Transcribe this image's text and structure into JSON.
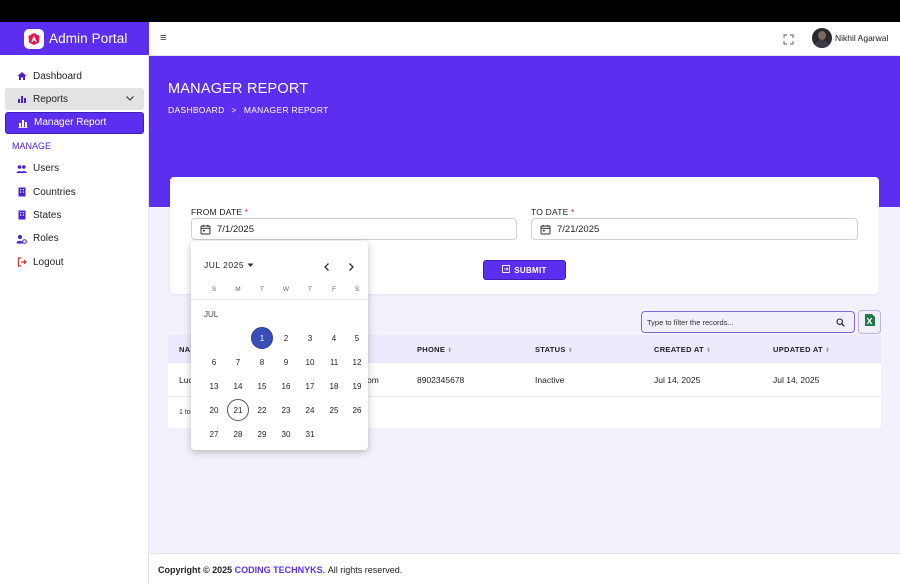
{
  "app": {
    "title": "Admin Portal",
    "accent": "#5b2ef0"
  },
  "sidebar": {
    "items": [
      {
        "label": "Dashboard",
        "icon": "home-icon"
      },
      {
        "label": "Reports",
        "icon": "bar-chart-icon"
      },
      {
        "label": "Manager Report",
        "icon": "bar-chart-outline-icon"
      }
    ],
    "section_label": "MANAGE",
    "manage_items": [
      {
        "label": "Users",
        "icon": "users-icon"
      },
      {
        "label": "Countries",
        "icon": "building-icon"
      },
      {
        "label": "States",
        "icon": "building-icon"
      },
      {
        "label": "Roles",
        "icon": "user-gear-icon"
      },
      {
        "label": "Logout",
        "icon": "logout-icon"
      }
    ]
  },
  "topbar": {
    "menu_icon": "≡",
    "user_name": "Nikhil Agarwal"
  },
  "hero": {
    "title": "MANAGER REPORT",
    "breadcrumb": [
      "DASHBOARD",
      ">",
      "MANAGER REPORT"
    ]
  },
  "filters": {
    "from_label": "FROM DATE",
    "from_value": "7/1/2025",
    "to_label": "TO DATE",
    "to_value": "7/21/2025",
    "required_mark": "*",
    "submit_label": "SUBMIT"
  },
  "search": {
    "placeholder": "Type to filter the records..."
  },
  "table": {
    "columns": [
      "NA",
      "PHONE",
      "STATUS",
      "CREATED AT",
      "UPDATED AT"
    ],
    "rows": [
      {
        "name": "Luc",
        "email_tail": "om",
        "phone": "8902345678",
        "status": "Inactive",
        "created": "Jul 14, 2025",
        "updated": "Jul 14, 2025"
      }
    ],
    "footer": "1 to"
  },
  "datepicker": {
    "month_year": "JUL 2025",
    "month_label": "JUL",
    "weekdays": [
      "S",
      "M",
      "T",
      "W",
      "T",
      "F",
      "S"
    ],
    "weeks": [
      [
        "",
        "",
        "1",
        "2",
        "3",
        "4",
        "5"
      ],
      [
        "6",
        "7",
        "8",
        "9",
        "10",
        "11",
        "12"
      ],
      [
        "13",
        "14",
        "15",
        "16",
        "17",
        "18",
        "19"
      ],
      [
        "20",
        "21",
        "22",
        "23",
        "24",
        "25",
        "26"
      ],
      [
        "27",
        "28",
        "29",
        "30",
        "31",
        "",
        ""
      ]
    ],
    "selected": "1",
    "today": "21"
  },
  "footer": {
    "prefix": "Copyright © 2025",
    "brand": "CODING TECHNYKS.",
    "suffix": "All rights reserved."
  }
}
